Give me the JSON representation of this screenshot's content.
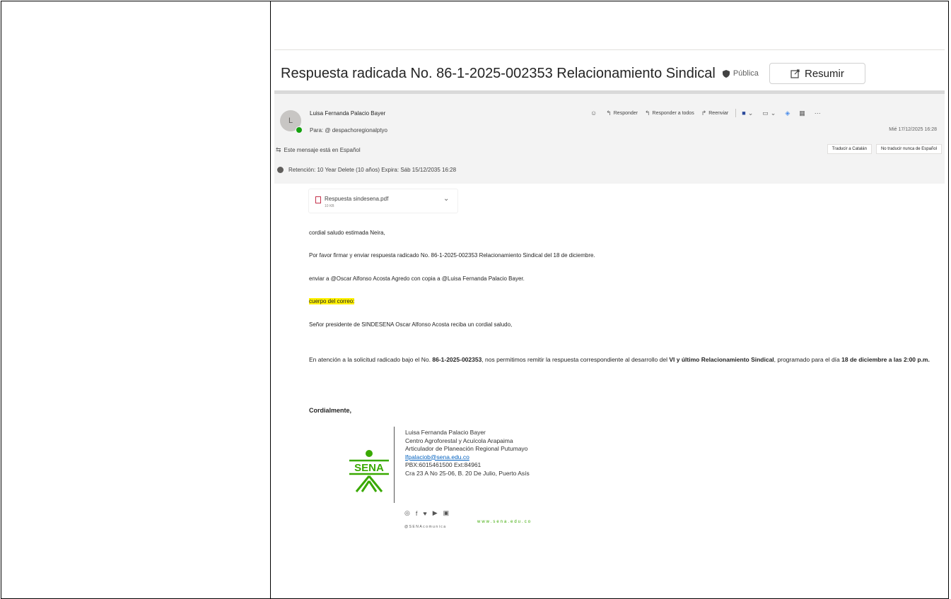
{
  "email": {
    "subject": "Respuesta radicada No. 86-1-2025-002353 Relacionamiento Sindical",
    "sensitivity": "Pública",
    "summarize_label": "Resumir",
    "avatar_initial": "L",
    "sender": "Luisa Fernanda Palacio Bayer",
    "to_label": "Para:",
    "to_value": "@ despachoregionalptyo",
    "datetime": "Mié 17/12/2025 16:28",
    "actions": {
      "reply": "Responder",
      "reply_all": "Responder a todos",
      "forward": "Reenviar"
    },
    "language_notice": "Este mensaje está en Español",
    "translate_button": "Traducir a Catalán",
    "never_translate_button": "No traducir nunca de Español",
    "retention": "Retención: 10 Year Delete (10 años) Expira: Sáb 15/12/2035 16:28",
    "attachment": {
      "name": "Respuesta sindesena.pdf",
      "size": "10 KB"
    },
    "body": {
      "greeting": "cordial saludo estimada Neira,",
      "line1": "Por favor firmar y enviar respuesta radicado No. 86-1-2025-002353 Relacionamiento Sindical del 18 de diciembre.",
      "line2": "enviar a @Oscar Alfonso Acosta Agredo con copia a @Luisa Fernanda Palacio Bayer.",
      "highlight": "cuerpo del correo:",
      "salutation": "Señor presidente de SINDESENA Oscar Alfonso Acosta  reciba un cordial saludo,",
      "p_a": "En atención a la solicitud radicado bajo el No. ",
      "p_b": "86-1-2025-002353",
      "p_c": ", nos permitimos remitir la respuesta correspondiente al desarrollo del ",
      "p_d": "VI y último Relacionamiento Sindical",
      "p_e": ", programado para el día ",
      "p_f": "18 de diciembre a las 2:00 p.m.",
      "closing": "Cordialmente,"
    },
    "signature": {
      "logo_text": "SENA",
      "name": "Luisa Fernanda Palacio Bayer",
      "center": "Centro Agroforestal y Acuícola Arapaima",
      "role": "Articulador de Planeación Regional Putumayo",
      "email": "lfpalaciob@sena.edu.co",
      "phone": "PBX:6015461500 Ext:84961",
      "address": "Cra 23 A No 25-06, B. 20 De Julio, Puerto Asís",
      "website": "www.sena.edu.co",
      "handle": "@SENAcomunica"
    },
    "colors": {
      "sena_green": "#39a900",
      "highlight": "#fff100",
      "presence": "#13a10e"
    }
  }
}
